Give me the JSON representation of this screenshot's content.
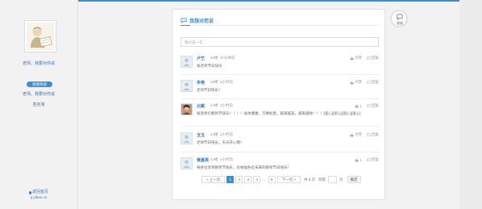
{
  "sidebar": {
    "link1": "老师，我要对你说",
    "badge": "感谢师恩",
    "link2": "老师，我要对你说",
    "link3": "签名墙",
    "home": "返回首页",
    "url": "q.yiban.cn"
  },
  "panel": {
    "title": "我想对您说",
    "input_placeholder": "我也说一句"
  },
  "comments": [
    {
      "user": "卢艺",
      "floor": "46楼",
      "time": "37分钟前",
      "text": "祝老师节日快乐",
      "likes": "",
      "like_label": "点赞",
      "reply_label": "回复"
    },
    {
      "user": "朱艳",
      "floor": "45楼",
      "time": "3小时前",
      "text": "老师节日快乐！",
      "likes": "",
      "like_label": "点赞",
      "reply_label": "回复"
    },
    {
      "user": "北鲲",
      "floor": "44楼",
      "time": "3小时前",
      "text": "祝老师们教师节快乐！！！！身体健康，万事如意，越来越美，越来越帅！！！[宽心][宽心][宽心][宽心]",
      "likes": "1",
      "like_label": "",
      "reply_label": "回复"
    },
    {
      "user": "玉玉",
      "floor": "43楼",
      "time": "3小时前",
      "text": "老师节日快乐，天天开心哦！",
      "likes": "",
      "like_label": "点赞",
      "reply_label": "回复"
    },
    {
      "user": "黄嘉英",
      "floor": "42楼",
      "time": "4小时前",
      "text": "祝各位老师教师节快乐，也祝福各位未来的教师节日快乐！",
      "likes": "1",
      "like_label": "",
      "reply_label": "回复"
    }
  ],
  "pager": {
    "prev": "« 上一页",
    "pages": [
      "1",
      "2",
      "3",
      "4"
    ],
    "current": "1",
    "ellipsis": "…",
    "last": "8",
    "next": "下一页 »",
    "total": "共 8 页",
    "goto": "到第",
    "page_unit": "页",
    "confirm": "确定"
  },
  "float_button": {
    "label": "说说"
  },
  "colors": {
    "accent": "#3a8fd1",
    "link": "#3c7ab8"
  }
}
